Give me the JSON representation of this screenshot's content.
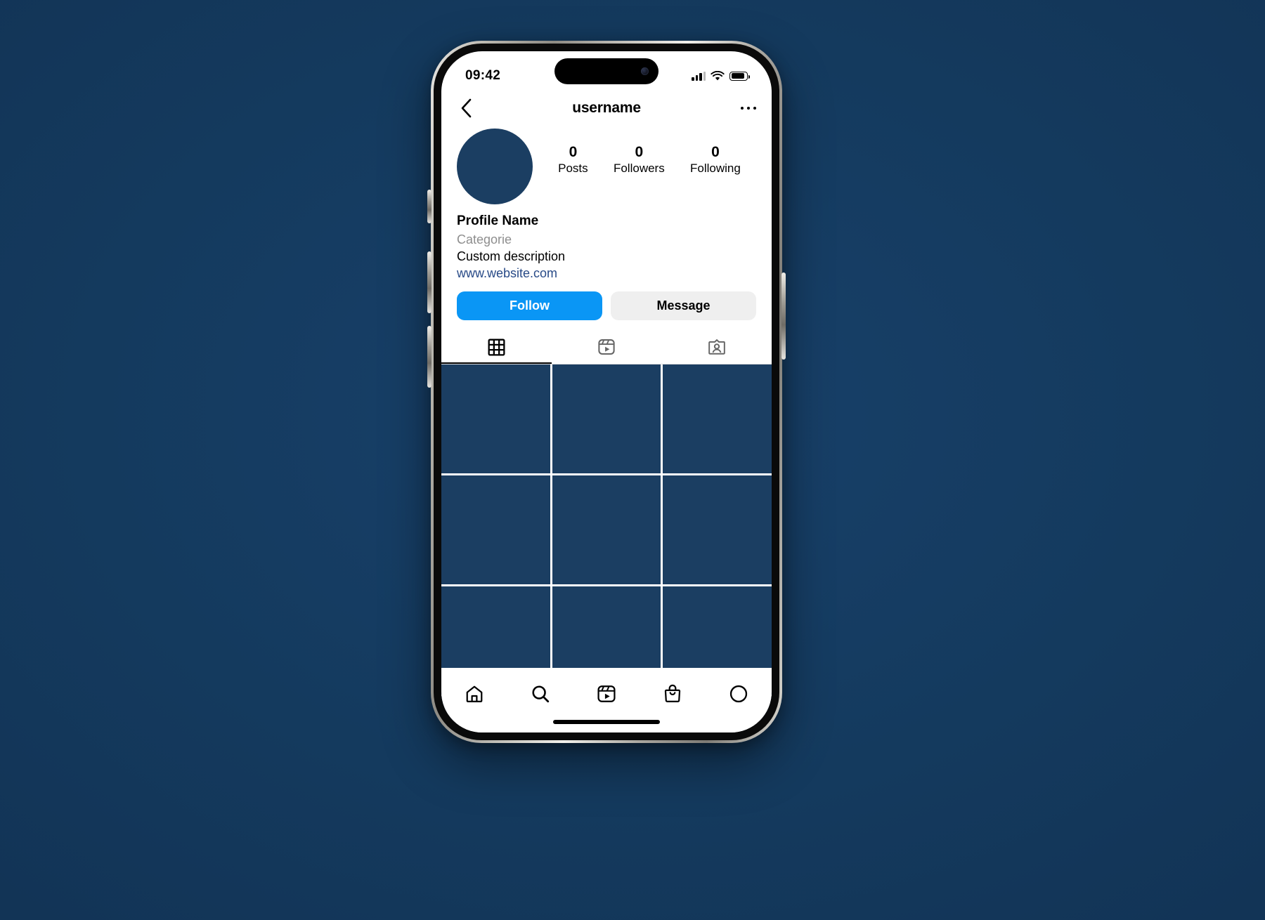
{
  "theme": {
    "backdrop_color": "#14395e",
    "accent_color": "#0a96f5",
    "tile_color": "#1b3e62",
    "link_color": "#284a87",
    "muted_text_color": "#8e8e8e",
    "secondary_button_color": "#efefef"
  },
  "status_bar": {
    "time": "09:42",
    "signal_icon": "cellular-signal-icon",
    "wifi_icon": "wifi-icon",
    "battery_icon": "battery-icon",
    "battery_level": 88
  },
  "nav_bar": {
    "back_icon": "chevron-left-icon",
    "title": "username",
    "more_icon": "ellipsis-icon"
  },
  "profile": {
    "avatar_icon": "avatar-placeholder",
    "stats": [
      {
        "value": "0",
        "label": "Posts"
      },
      {
        "value": "0",
        "label": "Followers"
      },
      {
        "value": "0",
        "label": "Following"
      }
    ],
    "name": "Profile Name",
    "category": "Categorie",
    "description": "Custom description",
    "website": "www.website.com"
  },
  "actions": {
    "follow_label": "Follow",
    "message_label": "Message"
  },
  "tabs": [
    {
      "name": "grid",
      "icon": "grid-icon",
      "active": true
    },
    {
      "name": "reels",
      "icon": "reels-icon",
      "active": false
    },
    {
      "name": "tagged",
      "icon": "tagged-person-icon",
      "active": false
    }
  ],
  "grid": {
    "columns": 3,
    "cell_count": 12,
    "cells_empty": true
  },
  "bottom_nav": [
    {
      "name": "home",
      "icon": "home-icon"
    },
    {
      "name": "search",
      "icon": "search-icon"
    },
    {
      "name": "reels",
      "icon": "reels-icon"
    },
    {
      "name": "shop",
      "icon": "shopping-bag-icon"
    },
    {
      "name": "profile",
      "icon": "profile-circle-icon"
    }
  ],
  "home_indicator": "home-indicator-bar"
}
